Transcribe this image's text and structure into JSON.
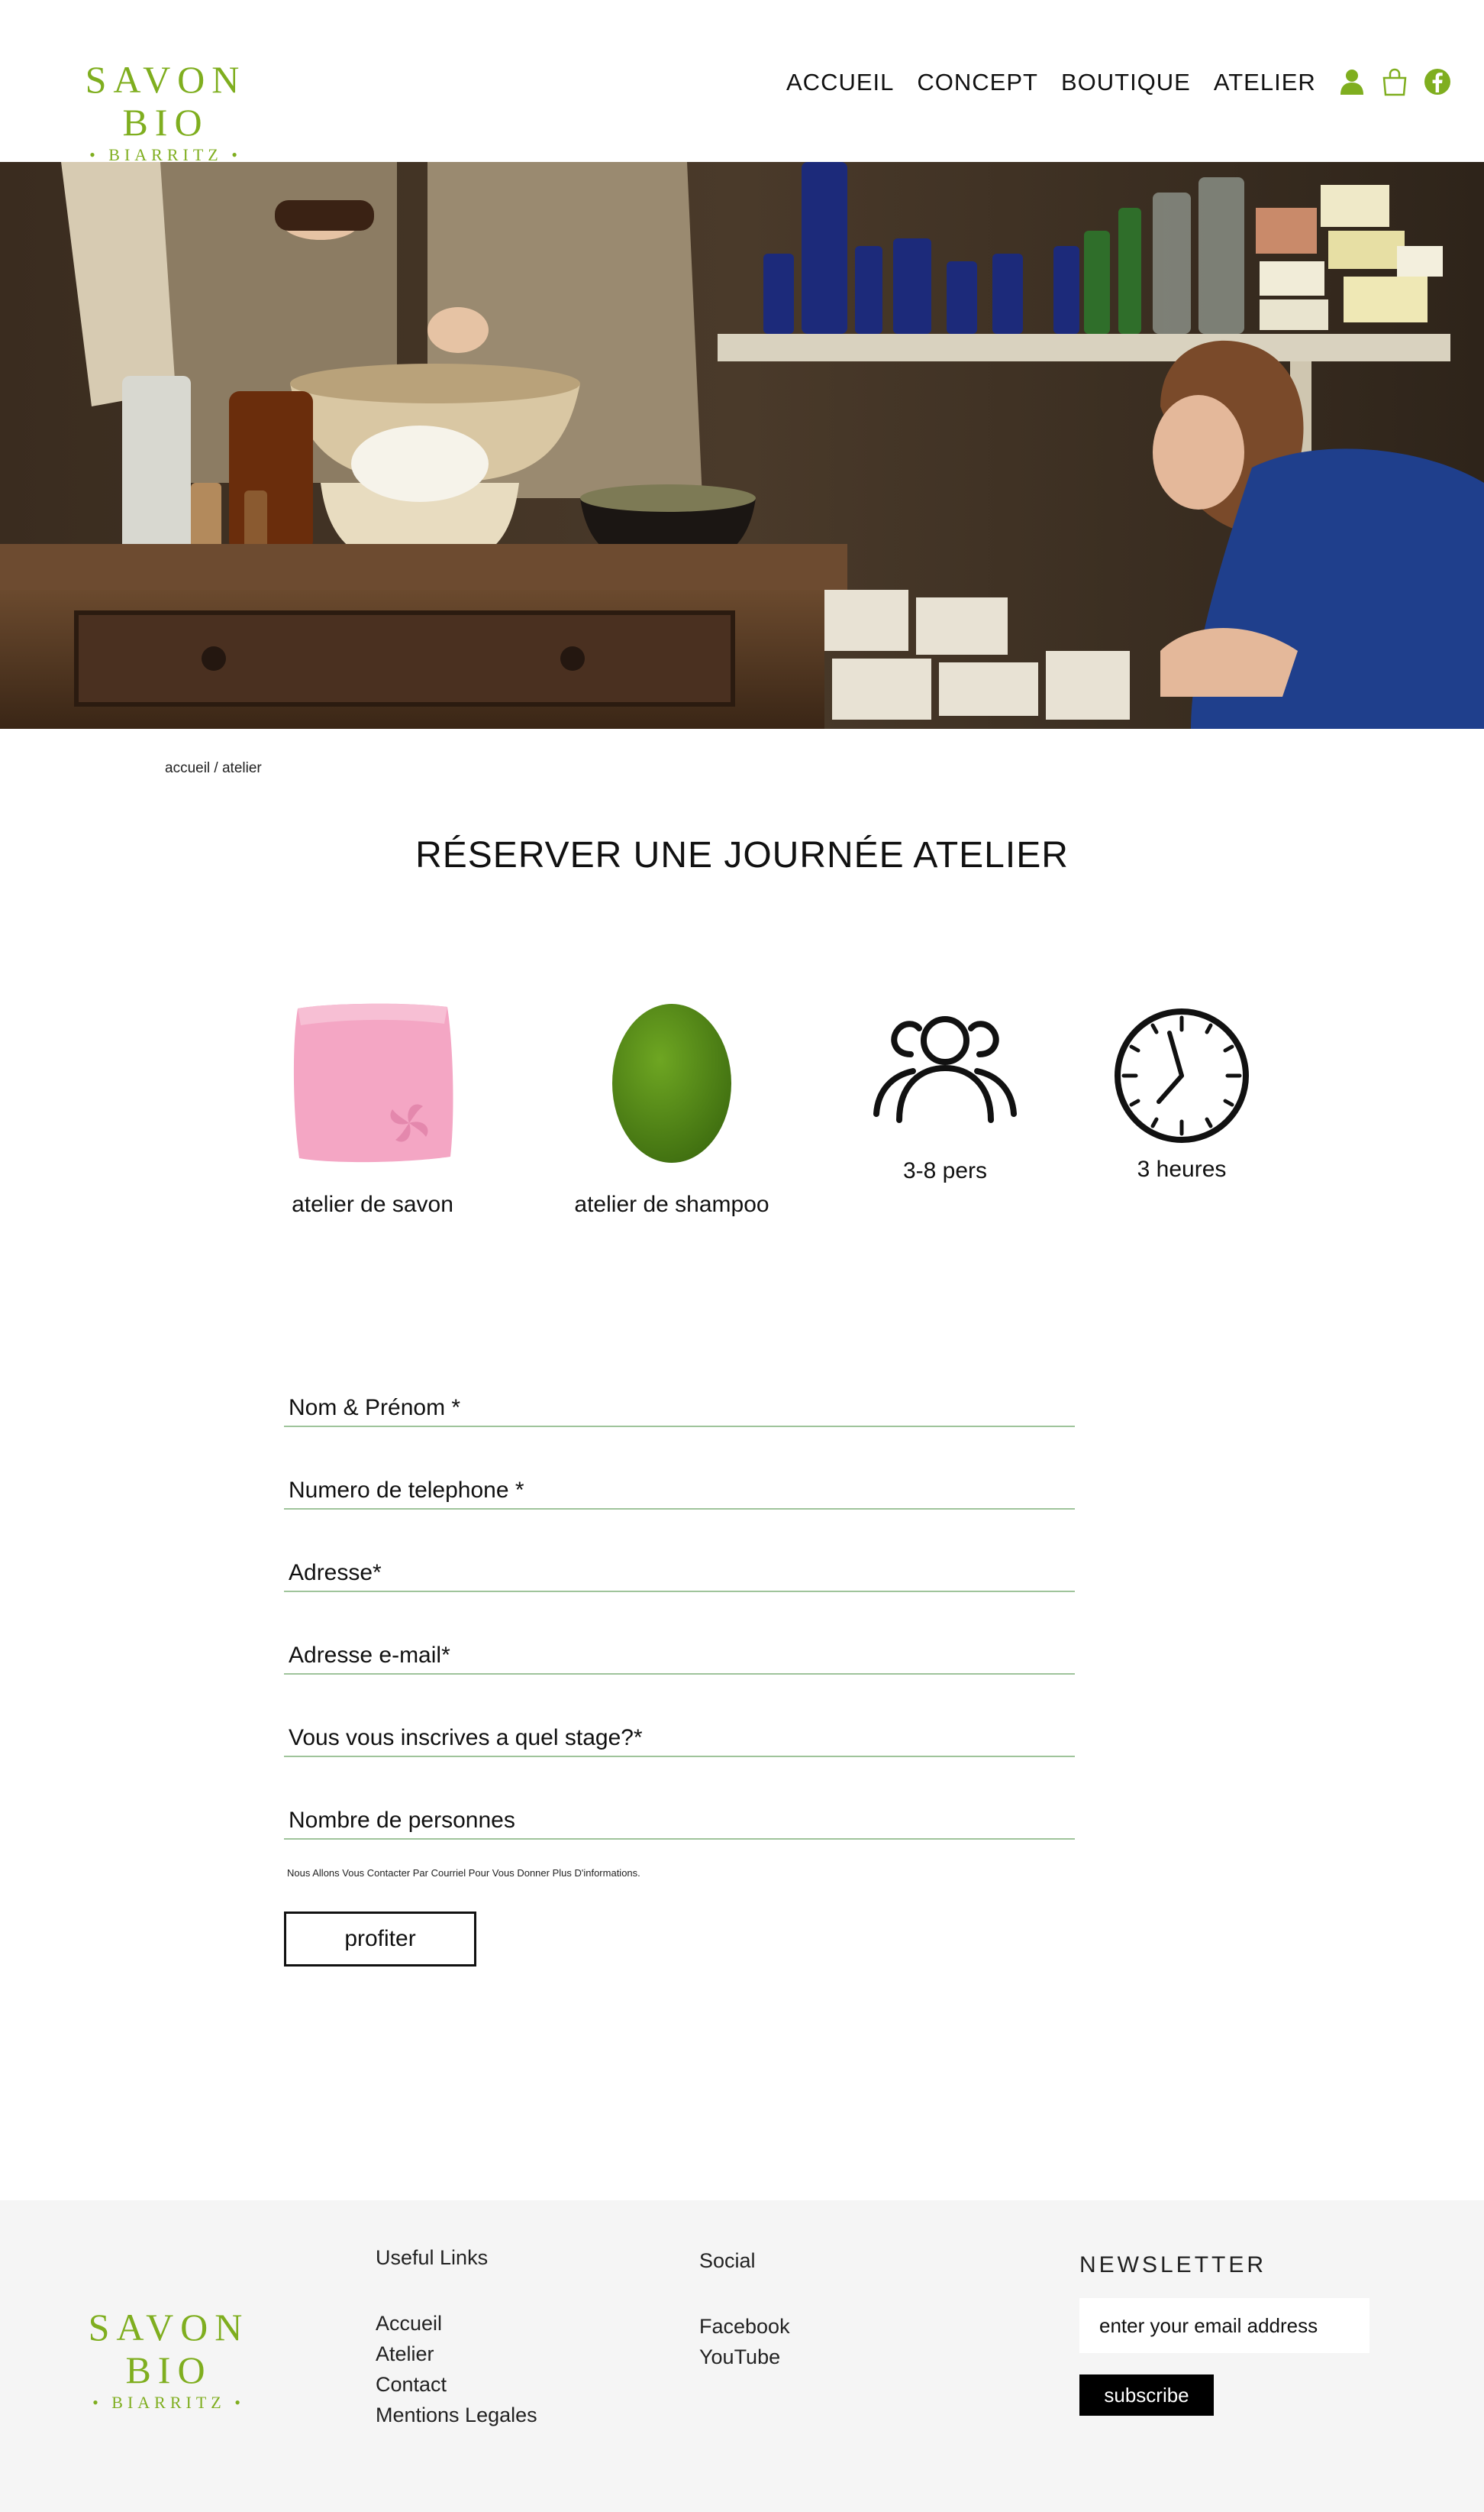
{
  "brand": {
    "name": "SAVON BIO",
    "city": "• BIARRITZ •",
    "accent": "#7fae1f"
  },
  "nav": {
    "items": [
      {
        "label": "ACCUEIL"
      },
      {
        "label": "CONCEPT"
      },
      {
        "label": "BOUTIQUE"
      },
      {
        "label": "ATELIER"
      }
    ],
    "icons": [
      "user-icon",
      "shopping-bag-icon",
      "facebook-icon"
    ]
  },
  "breadcrumb": "accueil / atelier",
  "page_title": "RÉSERVER UNE JOURNÉE ATELIER",
  "features": [
    {
      "icon": "pink-soap-bar-icon",
      "label": "atelier de savon"
    },
    {
      "icon": "green-shampoo-bar-icon",
      "label": "atelier de shampoo"
    },
    {
      "icon": "group-people-icon",
      "label": "3-8 pers"
    },
    {
      "icon": "clock-icon",
      "label": "3 heures"
    }
  ],
  "form": {
    "fields": [
      {
        "placeholder": "Nom & Prénom *",
        "value": ""
      },
      {
        "placeholder": "Numero de telephone *",
        "value": ""
      },
      {
        "placeholder": "Adresse*",
        "value": ""
      },
      {
        "placeholder": "Adresse e-mail*",
        "value": ""
      },
      {
        "placeholder": "Vous vous inscrives a quel stage?*",
        "value": ""
      },
      {
        "placeholder": "Nombre de personnes",
        "value": ""
      }
    ],
    "note": "Nous Allons Vous Contacter Par Courriel Pour Vous Donner Plus D'informations.",
    "submit_label": "profiter"
  },
  "footer": {
    "useful_links": {
      "heading": "Useful Links",
      "links": [
        "Accueil",
        "Atelier",
        "Contact",
        "Mentions Legales"
      ]
    },
    "social": {
      "heading": "Social",
      "links": [
        "Facebook",
        "YouTube"
      ]
    },
    "newsletter": {
      "heading": "NEWSLETTER",
      "placeholder": "enter your email address",
      "button_label": "subscribe"
    }
  }
}
